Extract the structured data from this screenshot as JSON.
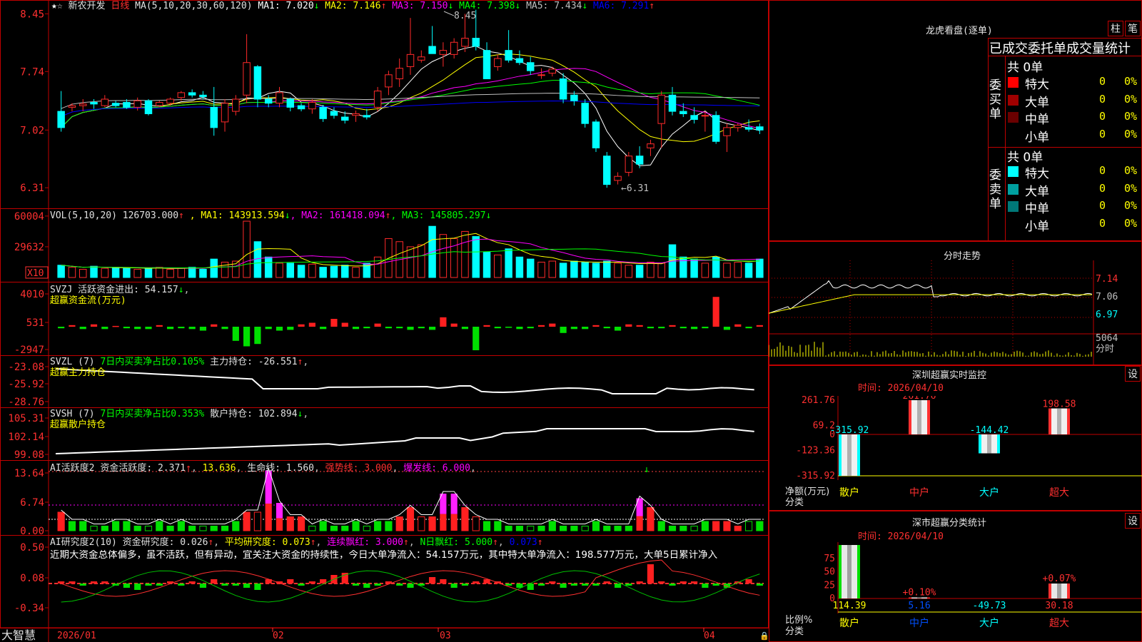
{
  "colors": {
    "up": "#ff2a2a",
    "down": "#00ffff",
    "ma1": "#ffffff",
    "ma2": "#ffff00",
    "ma3": "#ff00ff",
    "ma4": "#00ff00",
    "ma5": "#c0c0c0",
    "ma6": "#0000ff",
    "frame": "#c00000"
  },
  "main": {
    "stock_name": "新农开发",
    "period": "日线",
    "ma_def": "MA(5,10,20,30,60,120)",
    "ma": [
      {
        "label": "MA1: 7.020",
        "arrow": "↓",
        "color": "#ffffff"
      },
      {
        "label": "MA2: 7.146",
        "arrow": "↑",
        "color": "#ffff00"
      },
      {
        "label": "MA3: 7.150",
        "arrow": "↓",
        "color": "#ff00ff"
      },
      {
        "label": "MA4: 7.398",
        "arrow": "↓",
        "color": "#00ff00"
      },
      {
        "label": "MA5: 7.434",
        "arrow": "↓",
        "color": "#c0c0c0"
      },
      {
        "label": "MA6: 7.291",
        "arrow": "↑",
        "color": "#0000ff"
      }
    ],
    "y_ticks": [
      "8.45",
      "7.74",
      "7.02",
      "6.31"
    ],
    "high_note": "8.45",
    "low_note": "←6.31"
  },
  "vol": {
    "title": "VOL(5,10,20)",
    "value": "126703.000",
    "value_arrow": "↑",
    "ma": [
      {
        "label": "MA1: 143913.594",
        "arrow": "↓",
        "color": "#ffff00"
      },
      {
        "label": "MA2: 161418.094",
        "arrow": "↑",
        "color": "#ff00ff"
      },
      {
        "label": "MA3: 145805.297",
        "arrow": "↓",
        "color": "#00ff00"
      }
    ],
    "y_ticks": [
      "60004",
      "29632"
    ],
    "unit": "X10"
  },
  "svzj": {
    "title": "SVZJ",
    "label": "活跃资金进出: 54.157",
    "arrow": "↓",
    "sub": "超赢资金流(万元)",
    "y_ticks": [
      "4010",
      "531",
      "-2947"
    ]
  },
  "svzl": {
    "title": "SVZL (7)",
    "label1": "7日内买卖净占比0.105%",
    "label2": "主力持仓: -26.551",
    "arrow": "↑",
    "sub": "超赢主力持仓",
    "y_ticks": [
      "-23.08",
      "-25.92",
      "-28.76"
    ]
  },
  "svsh": {
    "title": "SVSH (7)",
    "label1": "7日内买卖净占比0.353%",
    "label2": "散户持仓: 102.894",
    "arrow": "↓",
    "sub": "超赢散户持仓",
    "y_ticks": [
      "105.31",
      "102.14",
      "99.08"
    ]
  },
  "ai1": {
    "title": "AI活跃度2",
    "l1": "资金活跃度: 2.371",
    "l2": "13.636",
    "l3": "生命线: 1.560",
    "l4": "强势线: 3.000",
    "l5": "爆发线: 6.000",
    "y_ticks": [
      "13.64",
      "6.74",
      "0.00"
    ]
  },
  "ai2": {
    "title": "AI研究度2(10)",
    "l1": "资金研究度: 0.026",
    "l2": "平均研究度: 0.073",
    "l3": "连续飘红: 3.000",
    "l4": "N日飘红: 5.000",
    "l5": "0.073",
    "comment": "近期大资金总体偏多，虽不活跃，但有异动，宜关注大资金的持续性，今日大单净流入：54.157万元，其中特大单净流入：198.577万元，大单5日累计净入",
    "y_ticks": [
      "0.50",
      "0.08",
      "-0.34"
    ]
  },
  "bottom": {
    "logo": "大智慧",
    "dates": [
      "2026/01",
      "02",
      "03",
      "04"
    ]
  },
  "right": {
    "lhb_title": "龙虎看盘(逐单)",
    "btn1": "柱",
    "btn2": "笔",
    "header": "已成交委托单成交量统计",
    "buy_label": "委买单",
    "sell_label": "委卖单",
    "buy_total": "共 0单",
    "sell_total": "共 0单",
    "buy_rows": [
      {
        "name": "特大",
        "n": "0",
        "p": "0%",
        "c": "#ff0000"
      },
      {
        "name": "大单",
        "n": "0",
        "p": "0%",
        "c": "#a00000"
      },
      {
        "name": "中单",
        "n": "0",
        "p": "0%",
        "c": "#6a0000"
      },
      {
        "name": "小单",
        "n": "0",
        "p": "0%",
        "c": "#000000"
      }
    ],
    "sell_rows": [
      {
        "name": "特大",
        "n": "0",
        "p": "0%",
        "c": "#00ffff"
      },
      {
        "name": "大单",
        "n": "0",
        "p": "0%",
        "c": "#00a0a0"
      },
      {
        "name": "中单",
        "n": "0",
        "p": "0%",
        "c": "#007878"
      },
      {
        "name": "小单",
        "n": "0",
        "p": "0%",
        "c": "#000000"
      }
    ],
    "fs_title": "分时走势",
    "fs_prices": [
      "7.14",
      "7.06",
      "6.97"
    ],
    "fs_vol": "5064",
    "fs_vol_unit": "分时",
    "mon_title": "深圳超赢实时监控",
    "set": "设",
    "mon_time": "时间: 2026/04/10",
    "mon_y": [
      "261.76",
      "69.2",
      "0",
      "-123.36",
      "-315.92"
    ],
    "mon_cats": [
      "散户",
      "中户",
      "大户",
      "超大"
    ],
    "mon_vals": [
      {
        "cat": "散户",
        "label": "-315.92",
        "v": -315.92
      },
      {
        "cat": "中户",
        "label": "261.76",
        "v": 261.76
      },
      {
        "cat": "大户",
        "label": "-144.42",
        "v": -144.42
      },
      {
        "cat": "超大",
        "label": "198.58",
        "v": 198.58
      }
    ],
    "mon_ylabel": "净额(万元)",
    "mon_xlabel": "分类",
    "cls_title": "深市超赢分类统计",
    "cls_time": "时间: 2026/04/10",
    "cls_y": [
      "75",
      "50",
      "25",
      "0"
    ],
    "cls_vals": [
      {
        "cat": "散户",
        "label": "114.39",
        "pct": "",
        "v": 100
      },
      {
        "cat": "中户",
        "label": "5.16",
        "pct": "+0.10%",
        "v": 2
      },
      {
        "cat": "大户",
        "label": "-49.73",
        "pct": "",
        "v": 0
      },
      {
        "cat": "超大",
        "label": "30.18",
        "pct": "+0.07%",
        "v": 28
      }
    ],
    "cls_ylabel": "比例%",
    "cls_xlabel": "分类"
  },
  "chart_data": [
    {
      "type": "candlestick",
      "title": "新农开发 日线",
      "ylim": [
        6.31,
        8.45
      ],
      "ohlc": [
        [
          7.25,
          7.5,
          7.0,
          7.05
        ],
        [
          7.3,
          7.35,
          7.25,
          7.32
        ],
        [
          7.32,
          7.4,
          7.25,
          7.34
        ],
        [
          7.36,
          7.4,
          7.28,
          7.34
        ],
        [
          7.32,
          7.45,
          7.3,
          7.4
        ],
        [
          7.35,
          7.38,
          7.3,
          7.32
        ],
        [
          7.36,
          7.4,
          7.28,
          7.3
        ],
        [
          7.3,
          7.42,
          7.26,
          7.38
        ],
        [
          7.38,
          7.4,
          7.2,
          7.22
        ],
        [
          7.32,
          7.38,
          7.3,
          7.36
        ],
        [
          7.35,
          7.42,
          7.32,
          7.4
        ],
        [
          7.42,
          7.5,
          7.38,
          7.48
        ],
        [
          7.48,
          7.52,
          7.42,
          7.45
        ],
        [
          7.45,
          7.5,
          7.4,
          7.43
        ],
        [
          7.3,
          7.55,
          6.95,
          7.05
        ],
        [
          7.12,
          7.4,
          7.0,
          7.35
        ],
        [
          7.25,
          7.45,
          7.2,
          7.4
        ],
        [
          7.45,
          8.2,
          7.35,
          7.85
        ],
        [
          7.8,
          7.82,
          7.3,
          7.4
        ],
        [
          7.4,
          7.45,
          7.3,
          7.35
        ],
        [
          7.35,
          7.55,
          7.3,
          7.48
        ],
        [
          7.4,
          7.42,
          7.25,
          7.3
        ],
        [
          7.32,
          7.35,
          7.25,
          7.28
        ],
        [
          7.28,
          7.4,
          7.22,
          7.36
        ],
        [
          7.3,
          7.33,
          7.12,
          7.16
        ],
        [
          7.25,
          7.3,
          7.16,
          7.2
        ],
        [
          7.18,
          7.25,
          7.1,
          7.14
        ],
        [
          7.2,
          7.26,
          7.12,
          7.22
        ],
        [
          7.2,
          7.28,
          7.15,
          7.18
        ],
        [
          7.3,
          7.55,
          7.25,
          7.5
        ],
        [
          7.55,
          7.75,
          7.45,
          7.7
        ],
        [
          7.65,
          7.9,
          7.55,
          7.78
        ],
        [
          7.8,
          8.4,
          7.7,
          7.95
        ],
        [
          7.88,
          8.0,
          7.85,
          7.92
        ],
        [
          8.05,
          8.3,
          8.0,
          7.96
        ],
        [
          7.95,
          8.1,
          7.8,
          8.0
        ],
        [
          7.95,
          8.15,
          7.9,
          8.1
        ],
        [
          8.05,
          8.45,
          7.98,
          8.15
        ],
        [
          8.15,
          8.5,
          8.0,
          8.05
        ],
        [
          8.0,
          8.1,
          7.65,
          7.65
        ],
        [
          7.8,
          7.95,
          7.75,
          7.9
        ],
        [
          8.0,
          8.25,
          7.85,
          7.88
        ],
        [
          7.9,
          8.0,
          7.82,
          7.85
        ],
        [
          7.85,
          7.92,
          7.7,
          7.75
        ],
        [
          7.7,
          7.78,
          7.65,
          7.7
        ],
        [
          7.72,
          7.8,
          7.68,
          7.77
        ],
        [
          7.65,
          7.72,
          7.35,
          7.4
        ],
        [
          7.45,
          7.5,
          7.32,
          7.38
        ],
        [
          7.35,
          7.4,
          7.05,
          7.1
        ],
        [
          7.12,
          7.15,
          6.75,
          6.8
        ],
        [
          6.7,
          6.75,
          6.31,
          6.35
        ],
        [
          6.4,
          6.5,
          6.35,
          6.45
        ],
        [
          6.5,
          6.75,
          6.45,
          6.7
        ],
        [
          6.7,
          6.82,
          6.55,
          6.6
        ],
        [
          6.8,
          6.9,
          6.7,
          6.85
        ],
        [
          7.1,
          7.5,
          6.8,
          7.45
        ],
        [
          7.45,
          7.55,
          7.2,
          7.25
        ],
        [
          7.25,
          7.35,
          7.18,
          7.22
        ],
        [
          7.2,
          7.3,
          7.1,
          7.15
        ],
        [
          7.2,
          7.25,
          7.0,
          7.2
        ],
        [
          7.2,
          7.25,
          6.85,
          6.88
        ],
        [
          6.95,
          7.1,
          6.75,
          7.05
        ],
        [
          7.05,
          7.1,
          7.0,
          7.08
        ],
        [
          7.05,
          7.15,
          7.0,
          7.03
        ],
        [
          7.06,
          7.1,
          6.97,
          7.02
        ]
      ]
    },
    {
      "type": "bar",
      "title": "VOL(5,10,20)",
      "ylim": [
        0,
        60004
      ],
      "values": [
        12,
        10,
        8,
        11,
        9,
        10,
        9,
        8,
        9,
        10,
        8,
        9,
        10,
        8,
        18,
        15,
        16,
        55,
        35,
        20,
        14,
        14,
        12,
        13,
        10,
        11,
        12,
        10,
        14,
        20,
        38,
        35,
        30,
        32,
        50,
        42,
        38,
        45,
        40,
        25,
        22,
        28,
        20,
        18,
        15,
        16,
        14,
        16,
        15,
        14,
        16,
        14,
        12,
        12,
        15,
        14,
        32,
        20,
        18,
        14,
        20,
        14,
        15,
        14,
        18
      ]
    }
  ]
}
